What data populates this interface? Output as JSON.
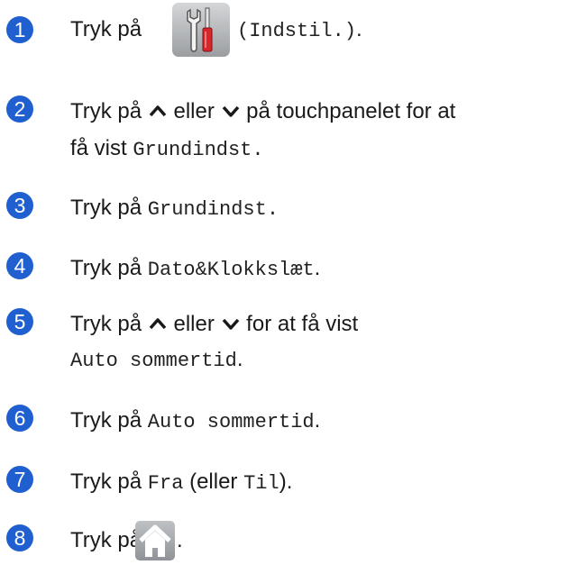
{
  "steps": [
    {
      "number": "1",
      "text_a": "Tryk på",
      "code_a": "(Indstil.)",
      "text_b": "."
    },
    {
      "number": "2",
      "text_a": "Tryk på",
      "text_b": "eller",
      "text_c": "på touchpanelet for at",
      "text_d": "få vist",
      "code_a": "Grundindst",
      "text_e": "."
    },
    {
      "number": "3",
      "text_a": "Tryk på",
      "code_a": "Grundindst",
      "text_b": "."
    },
    {
      "number": "4",
      "text_a": "Tryk på",
      "code_a": "Dato&Klokkslæt",
      "text_b": "."
    },
    {
      "number": "5",
      "text_a": "Tryk på",
      "text_b": "eller",
      "text_c": "for at få vist",
      "code_a": "Auto sommertid",
      "text_d": "."
    },
    {
      "number": "6",
      "text_a": "Tryk på",
      "code_a": "Auto sommertid",
      "text_b": "."
    },
    {
      "number": "7",
      "text_a": "Tryk på",
      "code_a": "Fra",
      "text_b": "(eller",
      "code_b": "Til",
      "text_c": ")."
    },
    {
      "number": "8",
      "text_a": "Tryk på",
      "text_b": "."
    }
  ],
  "icons": {
    "settings": "settings-tools-icon",
    "up": "chevron-up-icon",
    "down": "chevron-down-icon",
    "home": "home-icon"
  },
  "colors": {
    "step_badge": "#1f5fd0",
    "settings_screwdriver": "#d9262b",
    "icon_background": "#a9acaf"
  }
}
